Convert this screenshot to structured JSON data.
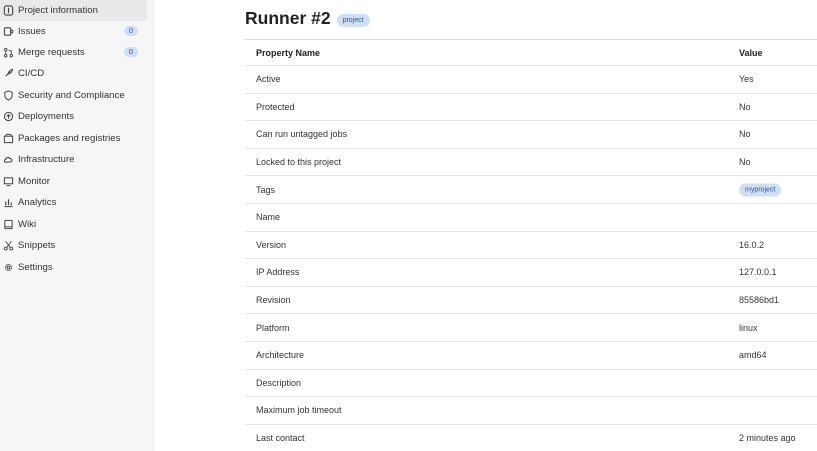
{
  "sidebar": {
    "items": [
      {
        "label": "Project information",
        "icon": "info-icon",
        "active": true
      },
      {
        "label": "Issues",
        "icon": "issues-icon",
        "badge": "0"
      },
      {
        "label": "Merge requests",
        "icon": "merge-request-icon",
        "badge": "0"
      },
      {
        "label": "CI/CD",
        "icon": "rocket-icon"
      },
      {
        "label": "Security and Compliance",
        "icon": "shield-icon"
      },
      {
        "label": "Deployments",
        "icon": "deployments-icon"
      },
      {
        "label": "Packages and registries",
        "icon": "package-icon"
      },
      {
        "label": "Infrastructure",
        "icon": "cloud-icon"
      },
      {
        "label": "Monitor",
        "icon": "monitor-icon"
      },
      {
        "label": "Analytics",
        "icon": "chart-icon"
      },
      {
        "label": "Wiki",
        "icon": "book-icon"
      },
      {
        "label": "Snippets",
        "icon": "scissors-icon"
      },
      {
        "label": "Settings",
        "icon": "gear-icon"
      }
    ]
  },
  "main": {
    "title": "Runner #2",
    "title_badge": "project",
    "table": {
      "headers": [
        "Property Name",
        "Value"
      ],
      "rows": [
        {
          "name": "Active",
          "value": "Yes"
        },
        {
          "name": "Protected",
          "value": "No"
        },
        {
          "name": "Can run untagged jobs",
          "value": "No"
        },
        {
          "name": "Locked to this project",
          "value": "No"
        },
        {
          "name": "Tags",
          "value": "myproject",
          "badge": true
        },
        {
          "name": "Name",
          "value": ""
        },
        {
          "name": "Version",
          "value": "16.0.2"
        },
        {
          "name": "IP Address",
          "value": "127.0.0.1"
        },
        {
          "name": "Revision",
          "value": "85586bd1"
        },
        {
          "name": "Platform",
          "value": "linux"
        },
        {
          "name": "Architecture",
          "value": "amd64"
        },
        {
          "name": "Description",
          "value": ""
        },
        {
          "name": "Maximum job timeout",
          "value": ""
        },
        {
          "name": "Last contact",
          "value": "2 minutes ago"
        }
      ]
    }
  },
  "colors": {
    "accent": "#1f5aa8",
    "badge_bg": "#cfe0f5",
    "sidebar_bg": "#f6f6f7"
  }
}
